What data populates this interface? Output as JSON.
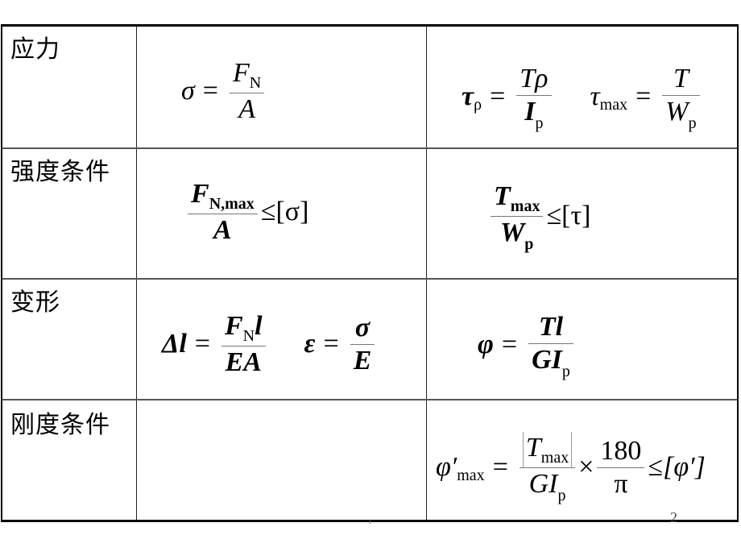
{
  "rows": [
    {
      "label": "应力"
    },
    {
      "label": "强度条件"
    },
    {
      "label": "变形"
    },
    {
      "label": "刚度条件"
    }
  ],
  "formulas": {
    "stress_axial": {
      "lhs": "σ",
      "eq": "=",
      "num": "F",
      "num_sub": "N",
      "den": "A"
    },
    "stress_torsion": {
      "lhs": "τ",
      "lhs_sub": "ρ",
      "eq": "=",
      "num": "Tρ",
      "den": "I",
      "den_sub": "p"
    },
    "stress_torsion_max": {
      "lhs": "τ",
      "lhs_sub": "max",
      "eq": "=",
      "num": "T",
      "den": "W",
      "den_sub": "p"
    },
    "strength_axial": {
      "num": "F",
      "num_sub": "N,max",
      "den": "A",
      "rel": "≤",
      "rhs": "[σ]"
    },
    "strength_torsion": {
      "num": "T",
      "num_sub": "max",
      "den": "W",
      "den_sub": "p",
      "rel": "≤",
      "rhs": "[τ]"
    },
    "deform_axial": {
      "lhs": "Δl",
      "eq": "=",
      "num": "F",
      "num_sub": "N",
      "num_tail": "l",
      "den": "EA"
    },
    "strain": {
      "lhs": "ε",
      "eq": "=",
      "num": "σ",
      "den": "E"
    },
    "deform_torsion": {
      "lhs": "φ",
      "eq": "=",
      "num": "Tl",
      "den": "GI",
      "den_sub": "p"
    },
    "stiffness_torsion": {
      "lhs": "φ′",
      "lhs_sub": "max",
      "eq": "=",
      "num": "T",
      "num_sub": "max",
      "den": "GI",
      "den_sub": "p",
      "times": "×",
      "num2": "180",
      "den2": "π",
      "rel": "≤",
      "rhs": "[φ′]"
    }
  },
  "page_number": "2"
}
